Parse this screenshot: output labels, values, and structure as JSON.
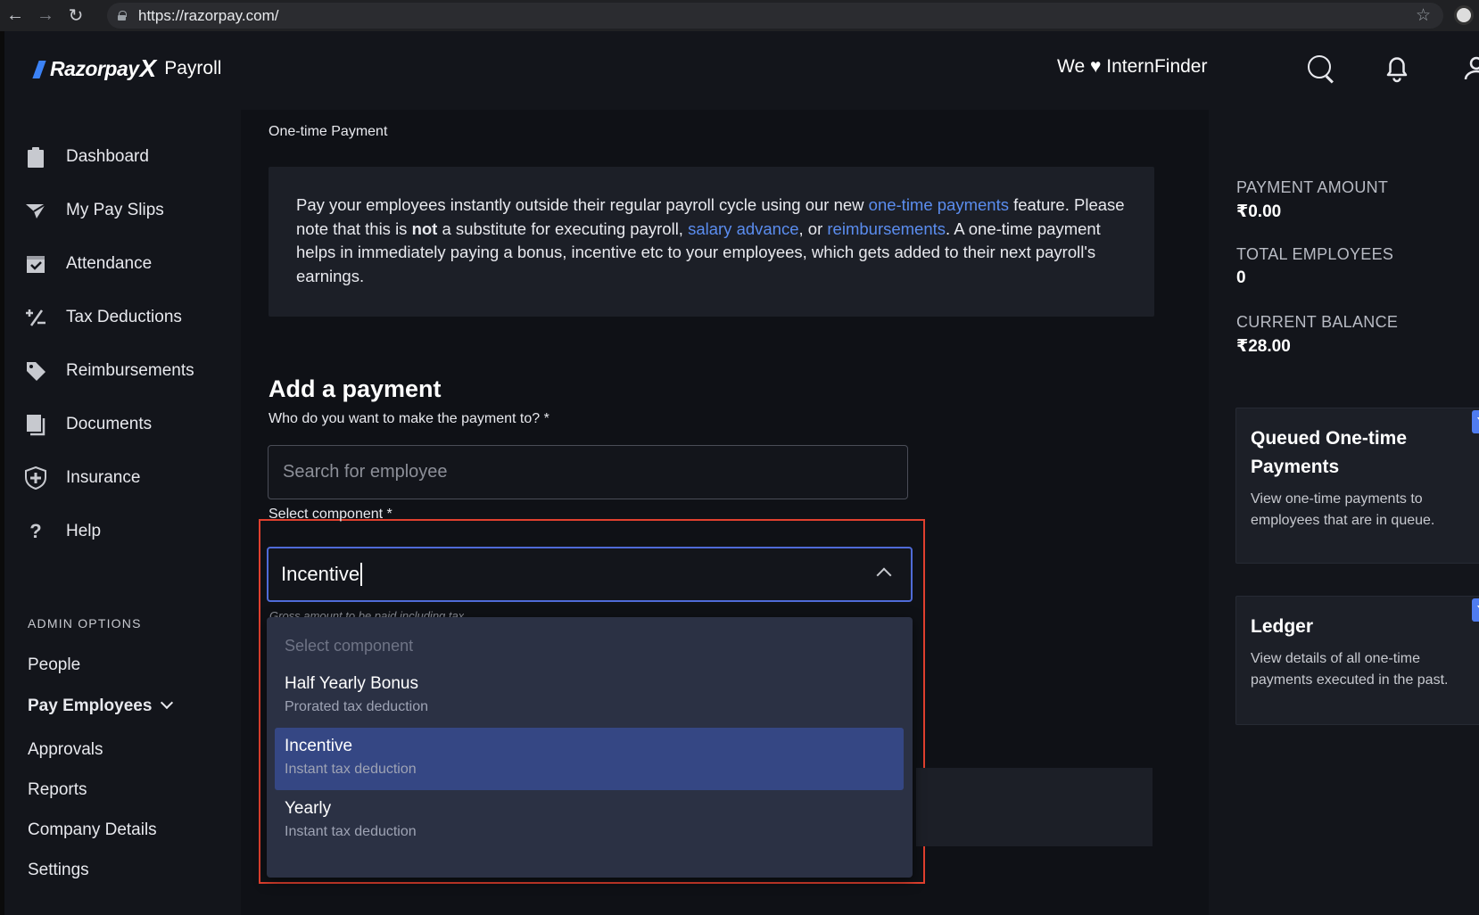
{
  "browser": {
    "url": "https://razorpay.com/"
  },
  "header": {
    "brand": "Razorpay",
    "brand_x": "X",
    "product": "Payroll",
    "org_label": "We ♥ InternFinder"
  },
  "sidebar": {
    "items": [
      {
        "label": "Dashboard",
        "icon": "clipboard-icon"
      },
      {
        "label": "My Pay Slips",
        "icon": "payslip-icon"
      },
      {
        "label": "Attendance",
        "icon": "calendar-check-icon"
      },
      {
        "label": "Tax Deductions",
        "icon": "percent-icon"
      },
      {
        "label": "Reimbursements",
        "icon": "tag-icon"
      },
      {
        "label": "Documents",
        "icon": "documents-icon"
      },
      {
        "label": "Insurance",
        "icon": "shield-plus-icon"
      },
      {
        "label": "Help",
        "icon": "question-icon"
      }
    ],
    "admin_section_label": "ADMIN OPTIONS",
    "admin_items": [
      {
        "label": "People"
      },
      {
        "label": "Pay Employees"
      },
      {
        "label": "Approvals"
      },
      {
        "label": "Reports"
      },
      {
        "label": "Company Details"
      },
      {
        "label": "Settings"
      }
    ]
  },
  "main": {
    "page_title": "One-time Payment",
    "info": {
      "p1": "Pay your employees instantly outside their regular payroll cycle using our new ",
      "link1": "one-time payments",
      "p2": " feature. Please note that this is ",
      "bold": "not",
      "p3": " a substitute for executing payroll, ",
      "link2": "salary advance",
      "p4": ", or ",
      "link3": "reimbursements",
      "p5": ". A one-time payment helps in immediately paying a bonus, incentive etc to your employees, which gets added to their next payroll's earnings."
    },
    "add_title": "Add a payment",
    "employee_label": "Who do you want to make the payment to? *",
    "employee_placeholder": "Search for employee",
    "component_label": "Select component *",
    "component_value": "Incentive",
    "helper_text": "Gross amount to be paid including tax",
    "dropdown": {
      "placeholder": "Select component",
      "options": [
        {
          "title": "Half Yearly Bonus",
          "subtitle": "Prorated tax deduction",
          "selected": false
        },
        {
          "title": "Incentive",
          "subtitle": "Instant tax deduction",
          "selected": true
        },
        {
          "title": "Yearly",
          "subtitle": "Instant tax deduction",
          "selected": false
        }
      ]
    }
  },
  "summary": {
    "payment_amount_label": "PAYMENT AMOUNT",
    "payment_amount_value": "₹0.00",
    "total_employees_label": "TOTAL EMPLOYEES",
    "total_employees_value": "0",
    "current_balance_label": "CURRENT BALANCE",
    "current_balance_value": "₹28.00",
    "cards": [
      {
        "title": "Queued One-time Payments",
        "description": "View one-time payments to employees that are in queue."
      },
      {
        "title": "Ledger",
        "description": "View details of all one-time payments executed in the past."
      }
    ]
  },
  "colors": {
    "accent": "#5b8def",
    "highlight_border": "#e0402e",
    "selected_option": "#354784"
  }
}
